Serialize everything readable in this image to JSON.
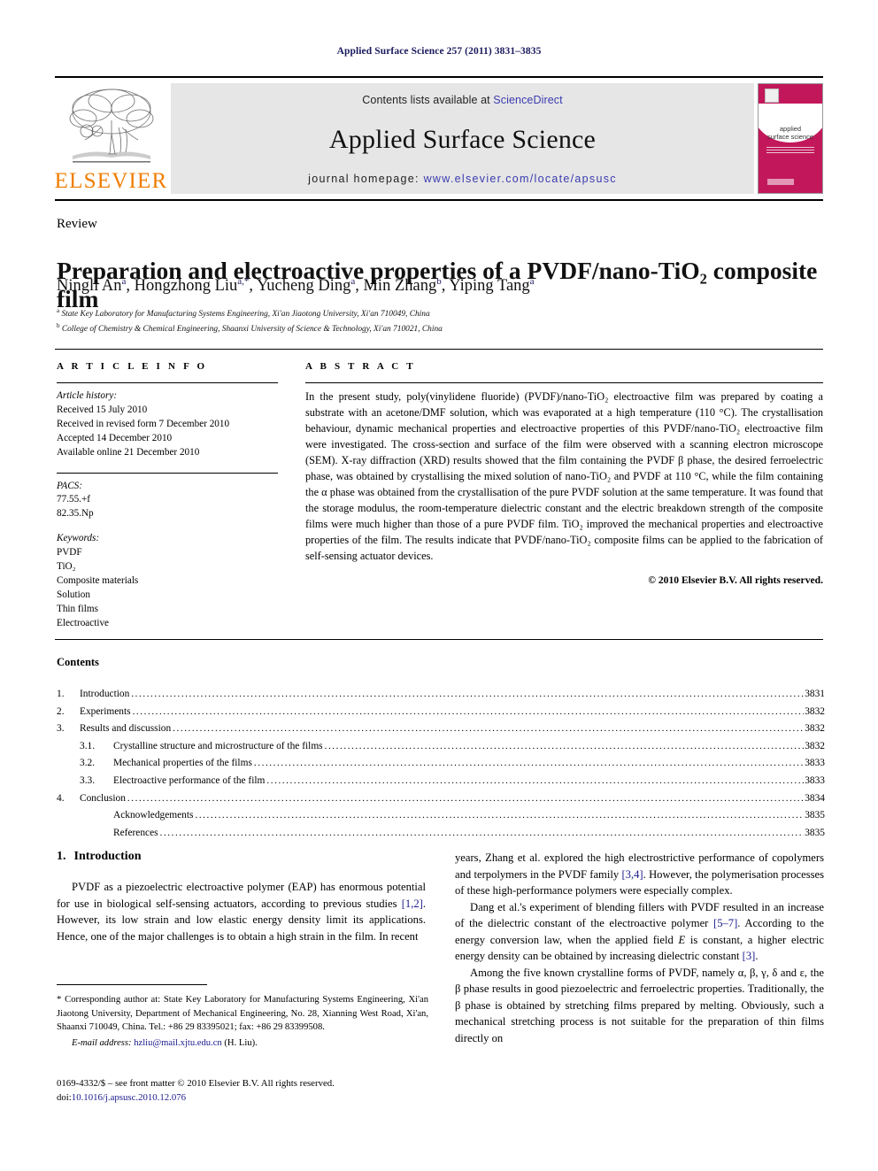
{
  "running_head": "Applied Surface Science 257 (2011) 3831–3835",
  "masthead": {
    "contents_prefix": "Contents lists available at ",
    "sciencedirect": "ScienceDirect",
    "journal_name": "Applied Surface Science",
    "homepage_prefix": "journal homepage: ",
    "homepage_url": "www.elsevier.com/locate/apsusc",
    "publisher": "ELSEVIER",
    "cover_title_line1": "applied",
    "cover_title_line2": "surface science",
    "accent_color": "#c2185b",
    "link_color": "#3b3bb0",
    "elsevier_orange": "#ef7d00"
  },
  "article": {
    "type_label": "Review",
    "title": "Preparation and electroactive properties of a PVDF/nano-TiO₂ composite film",
    "authors_html": "Ningli An<sup>a</sup>, Hongzhong Liu<sup>a,*</sup>, Yucheng Ding<sup>a</sup>, Min Zhang<sup>b</sup>, Yiping Tang<sup>a</sup>",
    "affiliations": [
      "State Key Laboratory for Manufacturing Systems Engineering, Xi'an Jiaotong University, Xi'an 710049, China",
      "College of Chemistry & Chemical Engineering, Shaanxi University of Science & Technology, Xi'an 710021, China"
    ]
  },
  "article_info": {
    "heading": "A R T I C L E    I N F O",
    "history_label": "Article history:",
    "history": [
      "Received 15 July 2010",
      "Received in revised form 7 December 2010",
      "Accepted 14 December 2010",
      "Available online 21 December 2010"
    ],
    "pacs_label": "PACS:",
    "pacs": [
      "77.55.+f",
      "82.35.Np"
    ],
    "keywords_label": "Keywords:",
    "keywords": [
      "PVDF",
      "TiO₂",
      "Composite materials",
      "Solution",
      "Thin films",
      "Electroactive"
    ]
  },
  "abstract": {
    "heading": "A B S T R A C T",
    "text": "In the present study, poly(vinylidene fluoride) (PVDF)/nano-TiO₂ electroactive film was prepared by coating a substrate with an acetone/DMF solution, which was evaporated at a high temperature (110 °C). The crystallisation behaviour, dynamic mechanical properties and electroactive properties of this PVDF/nano-TiO₂ electroactive film were investigated. The cross-section and surface of the film were observed with a scanning electron microscope (SEM). X-ray diffraction (XRD) results showed that the film containing the PVDF β phase, the desired ferroelectric phase, was obtained by crystallising the mixed solution of nano-TiO₂ and PVDF at 110 °C, while the film containing the α phase was obtained from the crystallisation of the pure PVDF solution at the same temperature. It was found that the storage modulus, the room-temperature dielectric constant and the electric breakdown strength of the composite films were much higher than those of a pure PVDF film. TiO₂ improved the mechanical properties and electroactive properties of the film. The results indicate that PVDF/nano-TiO₂ composite films can be applied to the fabrication of self-sensing actuator devices.",
    "copyright": "© 2010 Elsevier B.V. All rights reserved."
  },
  "contents": {
    "heading": "Contents",
    "entries": [
      {
        "num": "1.",
        "sub": "",
        "label": "Introduction",
        "page": "3831"
      },
      {
        "num": "2.",
        "sub": "",
        "label": "Experiments",
        "page": "3832"
      },
      {
        "num": "3.",
        "sub": "",
        "label": "Results and discussion",
        "page": "3832"
      },
      {
        "num": "",
        "sub": "3.1.",
        "label": "Crystalline structure and microstructure of the films",
        "page": "3832"
      },
      {
        "num": "",
        "sub": "3.2.",
        "label": "Mechanical properties of the films",
        "page": "3833"
      },
      {
        "num": "",
        "sub": "3.3.",
        "label": "Electroactive performance of the film",
        "page": "3833"
      },
      {
        "num": "4.",
        "sub": "",
        "label": "Conclusion",
        "page": "3834"
      },
      {
        "num": "",
        "sub": "",
        "label": "Acknowledgements",
        "page": "3835"
      },
      {
        "num": "",
        "sub": "",
        "label": "References",
        "page": "3835"
      }
    ]
  },
  "body": {
    "section_number": "1.",
    "section_title": "Introduction",
    "left_paragraph_1_html": "PVDF as a piezoelectric electroactive polymer (EAP) has enormous potential for use in biological self-sensing actuators, according to previous studies <span class=\"ref\">[1,2]</span>. However, its low strain and low elastic energy density limit its applications. Hence, one of the major challenges is to obtain a high strain in the film. In recent",
    "right_paragraph_1_html": "years, Zhang et al. explored the high electrostrictive performance of copolymers and terpolymers in the PVDF family <span class=\"ref\">[3,4]</span>. However, the polymerisation processes of these high-performance polymers were especially complex.",
    "right_paragraph_2_html": "Dang et al.'s experiment of blending fillers with PVDF resulted in an increase of the dielectric constant of the electroactive polymer <span class=\"ref\">[5–7]</span>. According to the energy conversion law, when the applied field <span class=\"em\">E</span> is constant, a higher electric energy density can be obtained by increasing dielectric constant <span class=\"ref\">[3]</span>.",
    "right_paragraph_3_html": "Among the five known crystalline forms of PVDF, namely α, β, γ, δ and ε, the β phase results in good piezoelectric and ferroelectric properties. Traditionally, the β phase is obtained by stretching films prepared by melting. Obviously, such a mechanical stretching process is not suitable for the preparation of thin films directly on"
  },
  "footnote": {
    "corresponding_html": "<span class=\"star\">*</span> Corresponding author at: State Key Laboratory for Manufacturing Systems Engineering, Xi'an Jiaotong University, Department of Mechanical Engineering, No. 28, Xianning West Road, Xi'an, Shaanxi 710049, China. Tel.: +86 29 83395021; fax: +86 29 83399508.",
    "email_label": "E-mail address:",
    "email": "hzliu@mail.xjtu.edu.cn",
    "email_suffix": " (H. Liu)."
  },
  "imprint": {
    "line1": "0169-4332/$ – see front matter © 2010 Elsevier B.V. All rights reserved.",
    "doi_label": "doi:",
    "doi": "10.1016/j.apsusc.2010.12.076"
  }
}
